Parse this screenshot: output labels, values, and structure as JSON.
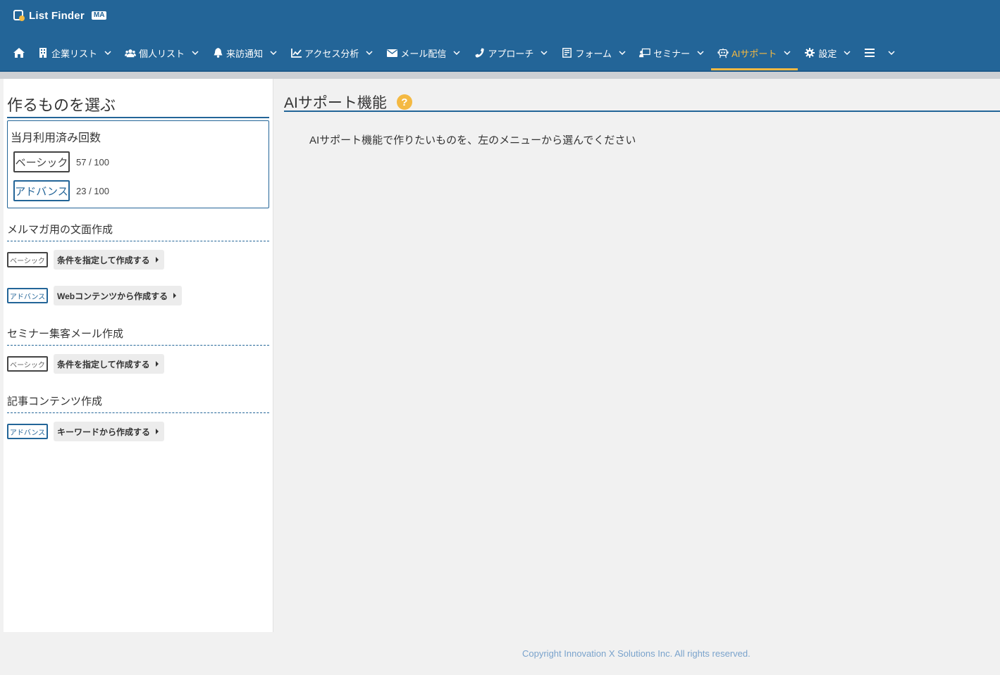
{
  "app": {
    "logo_text": "List Finder",
    "logo_badge": "MA"
  },
  "nav": {
    "items": [
      {
        "label": "企業リスト",
        "icon": "building-icon"
      },
      {
        "label": "個人リスト",
        "icon": "users-icon"
      },
      {
        "label": "来訪通知",
        "icon": "bell-icon"
      },
      {
        "label": "アクセス分析",
        "icon": "chart-line-icon"
      },
      {
        "label": "メール配信",
        "icon": "envelope-icon"
      },
      {
        "label": "アプローチ",
        "icon": "phone-icon"
      },
      {
        "label": "フォーム",
        "icon": "form-icon"
      },
      {
        "label": "セミナー",
        "icon": "presenter-icon"
      },
      {
        "label": "AIサポート",
        "icon": "robot-icon",
        "active": true
      },
      {
        "label": "設定",
        "icon": "gear-icon"
      }
    ],
    "accent_color": "#f4b942",
    "bar_color": "#236598"
  },
  "left": {
    "title": "作るものを選ぶ",
    "usage": {
      "title": "当月利用済み回数",
      "basic_label": "ベーシック",
      "basic_value": "57 / 100",
      "advance_label": "アドバンス",
      "advance_value": "23 / 100"
    },
    "tags": {
      "basic": "ベーシック",
      "advance": "アドバンス"
    },
    "sections": [
      {
        "heading": "メルマガ用の文面作成",
        "actions": [
          "条件を指定して作成する",
          "Webコンテンツから作成する"
        ]
      },
      {
        "heading": "セミナー集客メール作成",
        "actions": [
          "条件を指定して作成する"
        ]
      },
      {
        "heading": "記事コンテンツ作成",
        "actions": [
          "キーワードから作成する"
        ]
      }
    ]
  },
  "main": {
    "title": "AIサポート機能",
    "help": "?",
    "message": "AIサポート機能で作りたいものを、左のメニューから選んでください"
  },
  "footer": {
    "copyright": "Copyright Innovation X Solutions Inc. All rights reserved."
  }
}
